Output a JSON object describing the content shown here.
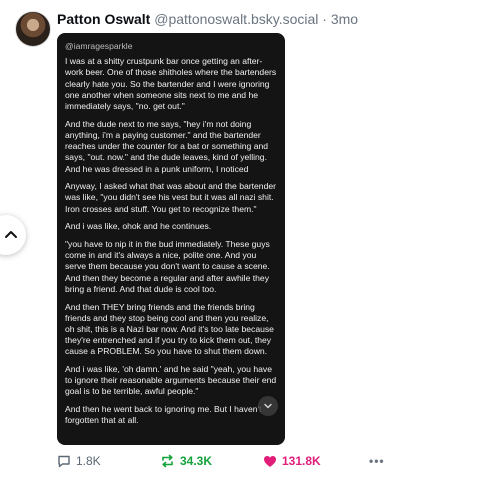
{
  "post": {
    "author_name": "Patton Oswalt",
    "author_handle": "@pattonoswalt.bsky.social",
    "separator": "·",
    "timestamp": "3mo"
  },
  "embed": {
    "quote_handle": "@iamragesparkle",
    "paragraphs": [
      "I was at a shitty crustpunk bar once getting an after-work beer. One of those shitholes where the bartenders clearly hate you. So the bartender and I were ignoring one another when someone sits next to me and he immediately says, \"no. get out.\"",
      "And the dude next to me says, \"hey i'm not doing anything, i'm a paying customer.\" and the bartender reaches under the counter for a bat or something and says, \"out. now.\" and the dude leaves, kind of yelling. And he was dressed in a punk uniform, I noticed",
      "Anyway, I asked what that was about and the bartender was like, \"you didn't see his vest but it was all nazi shit. Iron crosses and stuff. You get to recognize them.\"",
      "And i was like, ohok and he continues.",
      "\"you have to nip it in the bud immediately. These guys come in and it's always a nice, polite one. And you serve them because you don't want to cause a scene. And then they become a regular and after awhile they bring a friend. And that dude is cool too.",
      "And then THEY bring friends and the friends bring friends and they stop being cool and then you realize, oh shit, this is a Nazi bar now. And it's too late because they're entrenched and if you try to kick them out, they cause a PROBLEM. So you have to shut them down.",
      "And i was like, 'oh damn.' and he said \"yeah, you have to ignore their reasonable arguments because their end goal is to be terrible, awful people.\"",
      "And then he went back to ignoring me. But I haven't forgotten that at all."
    ]
  },
  "actions": {
    "reply_count": "1.8K",
    "repost_count": "34.3K",
    "like_count": "131.8K",
    "more_label": "•••"
  },
  "colors": {
    "repost": "#14a33a",
    "like": "#e01e7a",
    "muted": "#6a7581",
    "card_bg": "#141414"
  },
  "icons": {
    "back": "chevron-up-icon",
    "scroll": "chevron-down-icon",
    "reply": "speech-bubble-icon",
    "repost": "repost-arrows-icon",
    "like": "heart-icon",
    "more": "ellipsis-icon"
  }
}
